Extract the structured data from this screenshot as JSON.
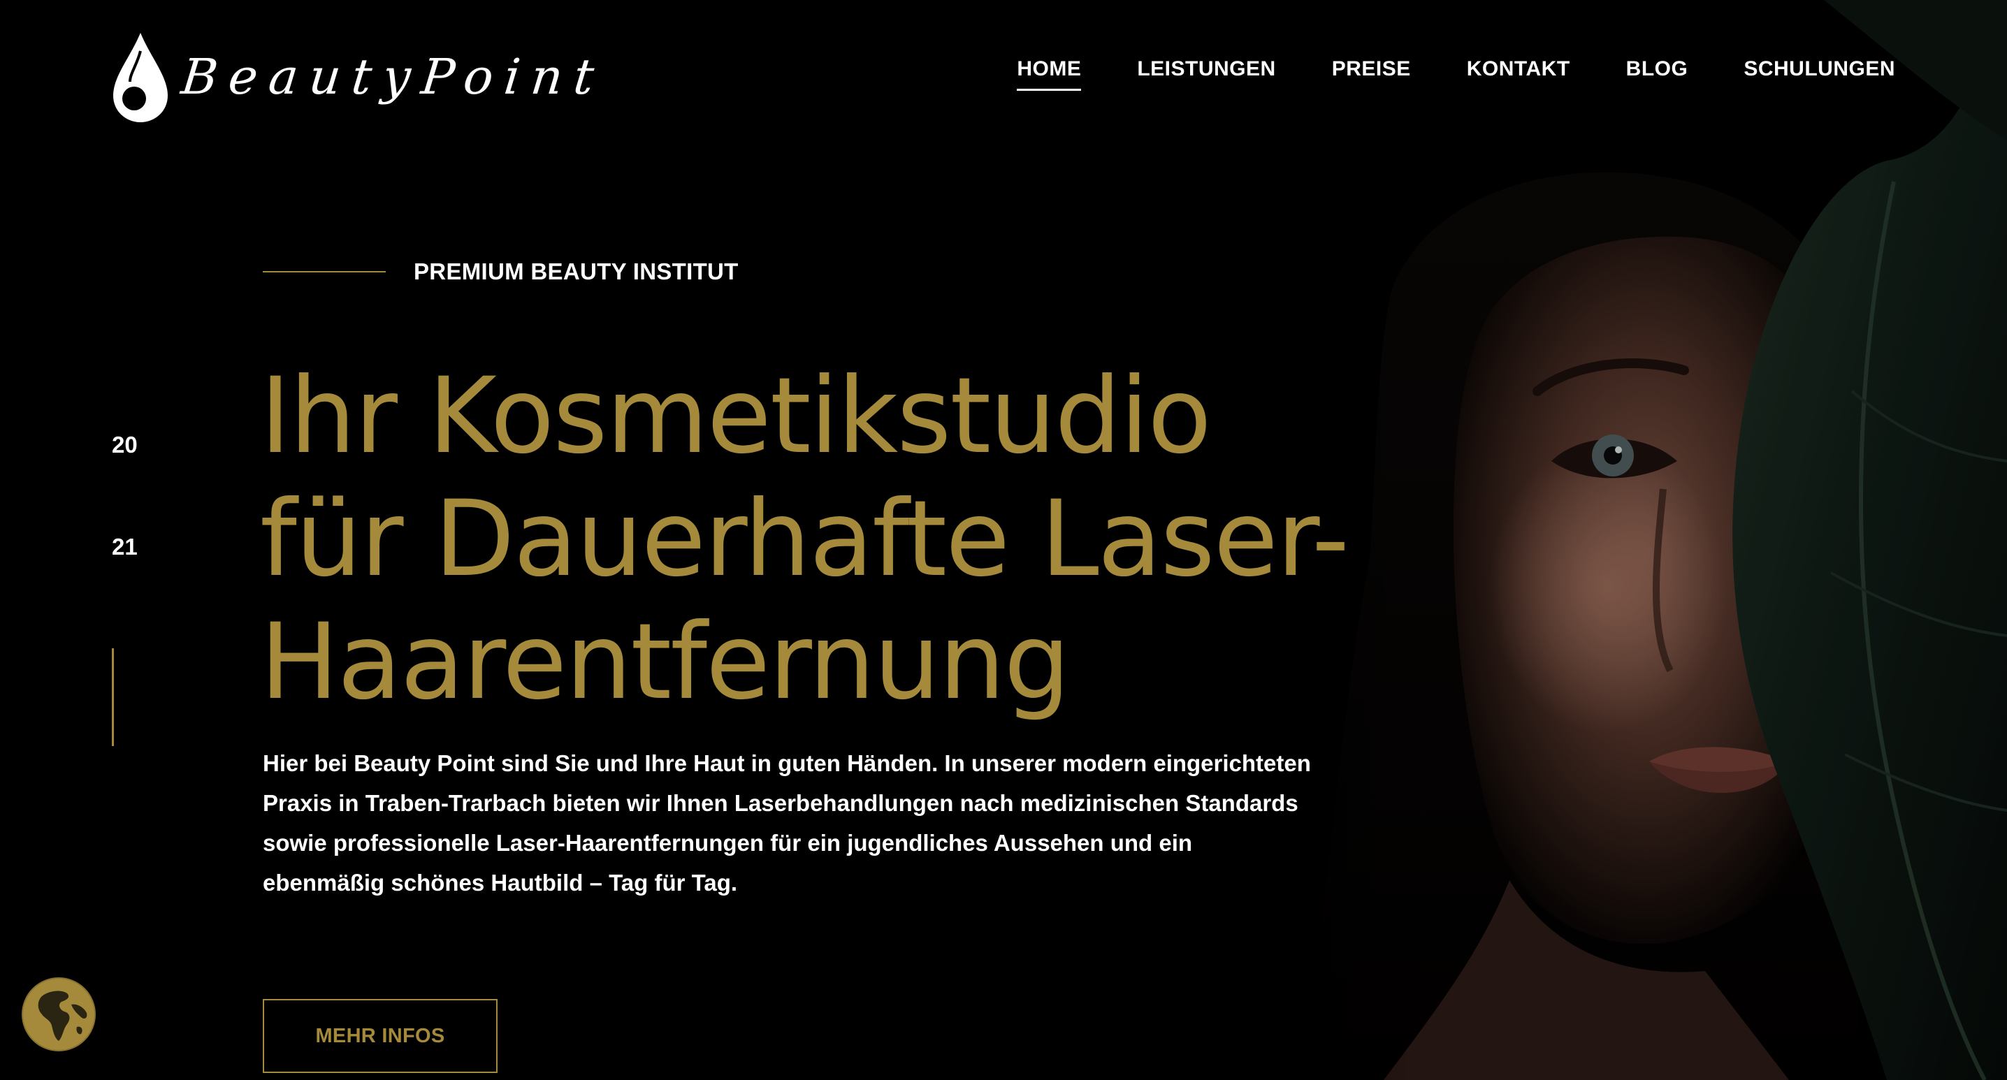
{
  "brand": {
    "name": "BeautyPoint"
  },
  "nav": {
    "items": [
      {
        "label": "HOME",
        "active": true
      },
      {
        "label": "LEISTUNGEN",
        "active": false
      },
      {
        "label": "PREISE",
        "active": false
      },
      {
        "label": "KONTAKT",
        "active": false
      },
      {
        "label": "BLOG",
        "active": false
      },
      {
        "label": "SCHULUNGEN",
        "active": false
      }
    ]
  },
  "hero": {
    "eyebrow": "PREMIUM BEAUTY INSTITUT",
    "headline_lines": [
      "Ihr Kosmetikstudio",
      "für Dauerhafte Laser-",
      "Haarentfernung"
    ],
    "body": "Hier bei Beauty Point sind Sie und Ihre Haut in guten Händen. In unserer modern eingerichteten Praxis in Traben-Trarbach bieten wir Ihnen Laserbehandlungen nach medizinischen Standards sowie professionelle Laser-Haarentfernungen für ein jugendliches Aussehen und ein ebenmäßig schönes Hautbild – Tag für Tag.",
    "cta_label": "MEHR INFOS",
    "image_icon": "portrait-with-leaf"
  },
  "year_indicator": {
    "top": "20",
    "bottom": "21"
  },
  "language_switcher": {
    "icon": "globe-icon"
  },
  "colors": {
    "background": "#000000",
    "accent_gold": "#a48a3a",
    "text": "#ffffff"
  }
}
